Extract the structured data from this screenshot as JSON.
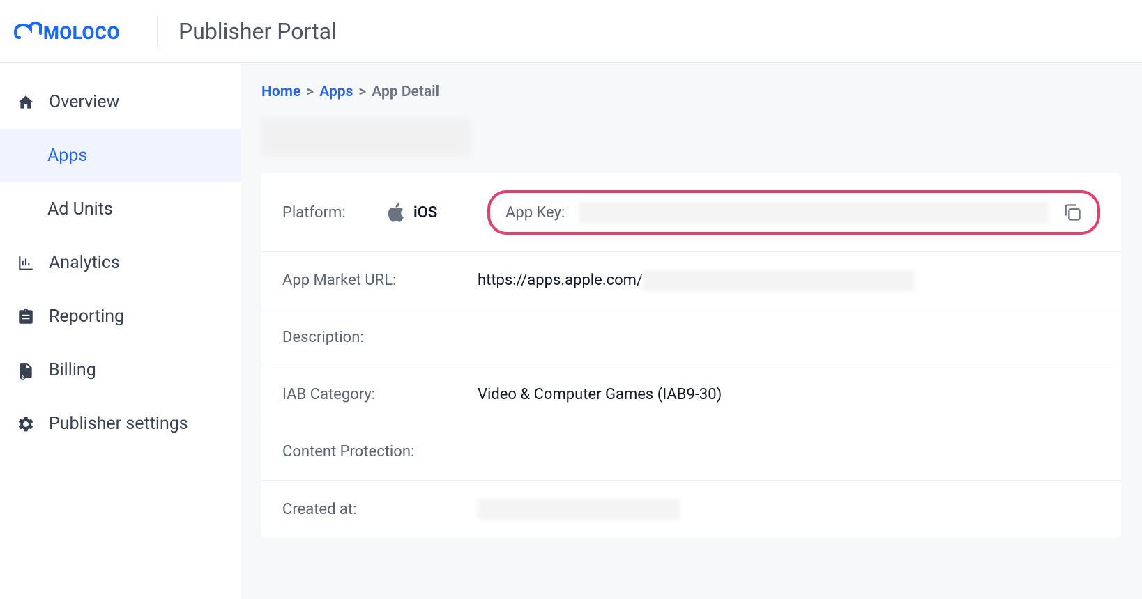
{
  "header": {
    "logo_text": "MOLOCO",
    "portal_title": "Publisher Portal"
  },
  "sidebar": {
    "items": [
      {
        "id": "overview",
        "label": "Overview",
        "icon": "home",
        "active": false,
        "sub": false
      },
      {
        "id": "apps",
        "label": "Apps",
        "icon": "",
        "active": true,
        "sub": true
      },
      {
        "id": "adunits",
        "label": "Ad Units",
        "icon": "",
        "active": false,
        "sub": true
      },
      {
        "id": "analytics",
        "label": "Analytics",
        "icon": "chart",
        "active": false,
        "sub": false
      },
      {
        "id": "reporting",
        "label": "Reporting",
        "icon": "clipboard",
        "active": false,
        "sub": false
      },
      {
        "id": "billing",
        "label": "Billing",
        "icon": "file-dollar",
        "active": false,
        "sub": false
      },
      {
        "id": "settings",
        "label": "Publisher settings",
        "icon": "gear",
        "active": false,
        "sub": false
      }
    ]
  },
  "breadcrumb": {
    "items": [
      {
        "label": "Home",
        "link": true
      },
      {
        "label": "Apps",
        "link": true
      },
      {
        "label": "App Detail",
        "link": false
      }
    ],
    "separator": ">"
  },
  "details": {
    "platform_label": "Platform:",
    "platform_value": "iOS",
    "app_key_label": "App Key:",
    "app_key_value": "",
    "market_url_label": "App Market URL:",
    "market_url_prefix": "https://apps.apple.com/",
    "description_label": "Description:",
    "description_value": "",
    "iab_label": "IAB Category:",
    "iab_value": "Video & Computer Games (IAB9-30)",
    "content_protection_label": "Content Protection:",
    "content_protection_value": "",
    "created_at_label": "Created at:",
    "created_at_value": ""
  }
}
